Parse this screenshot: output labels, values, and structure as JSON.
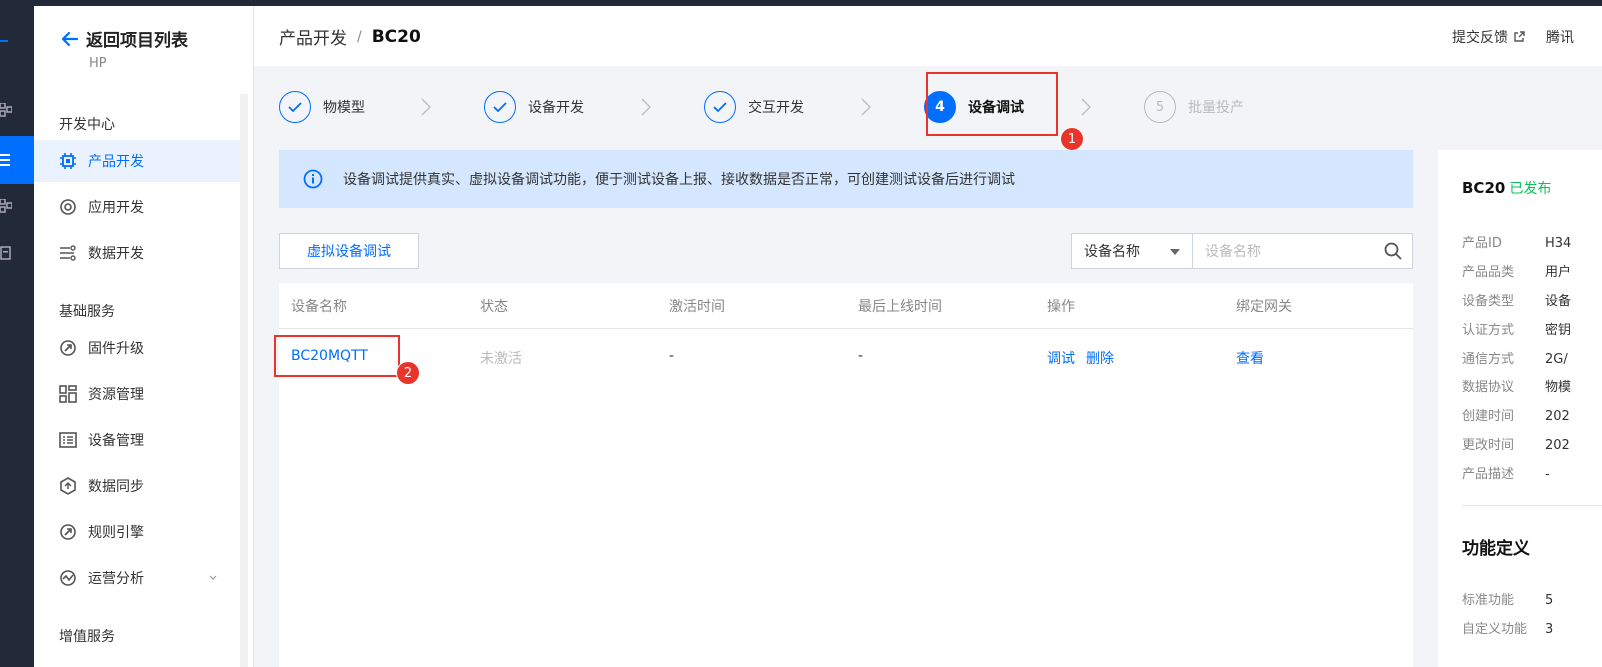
{
  "sidebar": {
    "back_label": "返回项目列表",
    "project_code": "HP",
    "section_dev": "开发中心",
    "section_base": "基础服务",
    "section_value": "增值服务",
    "items": [
      {
        "label": "产品开发",
        "icon": "chip-icon"
      },
      {
        "label": "应用开发",
        "icon": "app-icon"
      },
      {
        "label": "数据开发",
        "icon": "data-flow-icon"
      },
      {
        "label": "固件升级",
        "icon": "firmware-icon"
      },
      {
        "label": "资源管理",
        "icon": "resource-icon"
      },
      {
        "label": "设备管理",
        "icon": "device-list-icon"
      },
      {
        "label": "数据同步",
        "icon": "sync-icon"
      },
      {
        "label": "规则引擎",
        "icon": "rule-icon"
      },
      {
        "label": "运营分析",
        "icon": "analytics-icon"
      }
    ]
  },
  "header": {
    "crumb_parent": "产品开发",
    "crumb_sep": "/",
    "crumb_current": "BC20",
    "feedback": "提交反馈",
    "tencent": "腾讯"
  },
  "steps": [
    {
      "num": "",
      "label": "物模型",
      "state": "done"
    },
    {
      "num": "",
      "label": "设备开发",
      "state": "done"
    },
    {
      "num": "",
      "label": "交互开发",
      "state": "done"
    },
    {
      "num": "4",
      "label": "设备调试",
      "state": "current"
    },
    {
      "num": "5",
      "label": "批量投产",
      "state": "todo"
    }
  ],
  "annotations": {
    "badge1": "1",
    "badge2": "2"
  },
  "info": {
    "text": "设备调试提供真实、虚拟设备调试功能，便于测试设备上报、接收数据是否正常，可创建测试设备后进行调试"
  },
  "toolbar": {
    "virtual_button": "虚拟设备调试",
    "filter_select": "设备名称",
    "search_placeholder": "设备名称"
  },
  "table": {
    "headers": [
      "设备名称",
      "状态",
      "激活时间",
      "最后上线时间",
      "操作",
      "绑定网关"
    ],
    "rows": [
      {
        "name": "BC20MQTT",
        "status": "未激活",
        "activated": "-",
        "last_online": "-",
        "op_debug": "调试",
        "op_delete": "删除",
        "gateway": "查看"
      }
    ]
  },
  "product_panel": {
    "name": "BC20",
    "status": "已发布",
    "fields": [
      {
        "k": "产品ID",
        "v": "H34"
      },
      {
        "k": "产品品类",
        "v": "用户"
      },
      {
        "k": "设备类型",
        "v": "设备"
      },
      {
        "k": "认证方式",
        "v": "密钥"
      },
      {
        "k": "通信方式",
        "v": "2G/"
      },
      {
        "k": "数据协议",
        "v": "物模"
      },
      {
        "k": "创建时间",
        "v": "202"
      },
      {
        "k": "更改时间",
        "v": "202"
      },
      {
        "k": "产品描述",
        "v": "-"
      }
    ],
    "func_title": "功能定义",
    "func_fields": [
      {
        "k": "标准功能",
        "v": "5"
      },
      {
        "k": "自定义功能",
        "v": "3"
      }
    ]
  },
  "colors": {
    "accent": "#006eff",
    "annotation": "#e8342b",
    "published": "#0abf5b"
  }
}
